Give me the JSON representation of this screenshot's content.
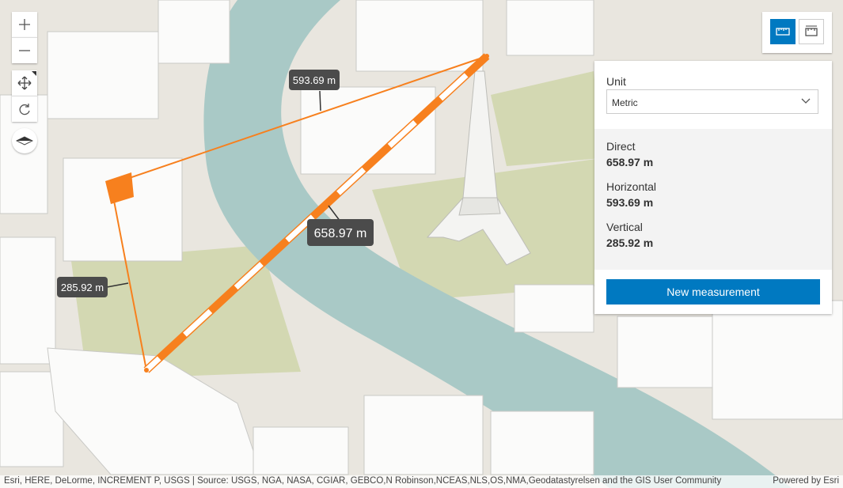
{
  "map": {
    "colors": {
      "land": "#e9e6df",
      "water": "#a9c9c6",
      "park": "#c8d0a8",
      "building": "#fbfbfa",
      "accent": "#f7801e"
    },
    "measurement_labels": {
      "horizontal": "593.69 m",
      "direct": "658.97 m",
      "vertical": "285.92 m"
    }
  },
  "controls": {
    "zoom_in_icon": "plus-icon",
    "zoom_out_icon": "minus-icon",
    "pan_icon": "move-icon",
    "rotate_icon": "rotate-icon",
    "compass_icon": "compass-icon"
  },
  "toolbar": {
    "distance_icon": "direct-line-measure-icon",
    "area_icon": "area-measure-icon"
  },
  "panel": {
    "unit_label": "Unit",
    "unit_value": "Metric",
    "results": [
      {
        "label": "Direct",
        "value": "658.97 m"
      },
      {
        "label": "Horizontal",
        "value": "593.69 m"
      },
      {
        "label": "Vertical",
        "value": "285.92 m"
      }
    ],
    "new_measurement_label": "New measurement"
  },
  "footer": {
    "attribution": "Esri, HERE, DeLorme, INCREMENT P, USGS | Source: USGS, NGA, NASA, CGIAR, GEBCO,N Robinson,NCEAS,NLS,OS,NMA,Geodatastyrelsen and the GIS User Community",
    "powered_by": "Powered by Esri"
  }
}
